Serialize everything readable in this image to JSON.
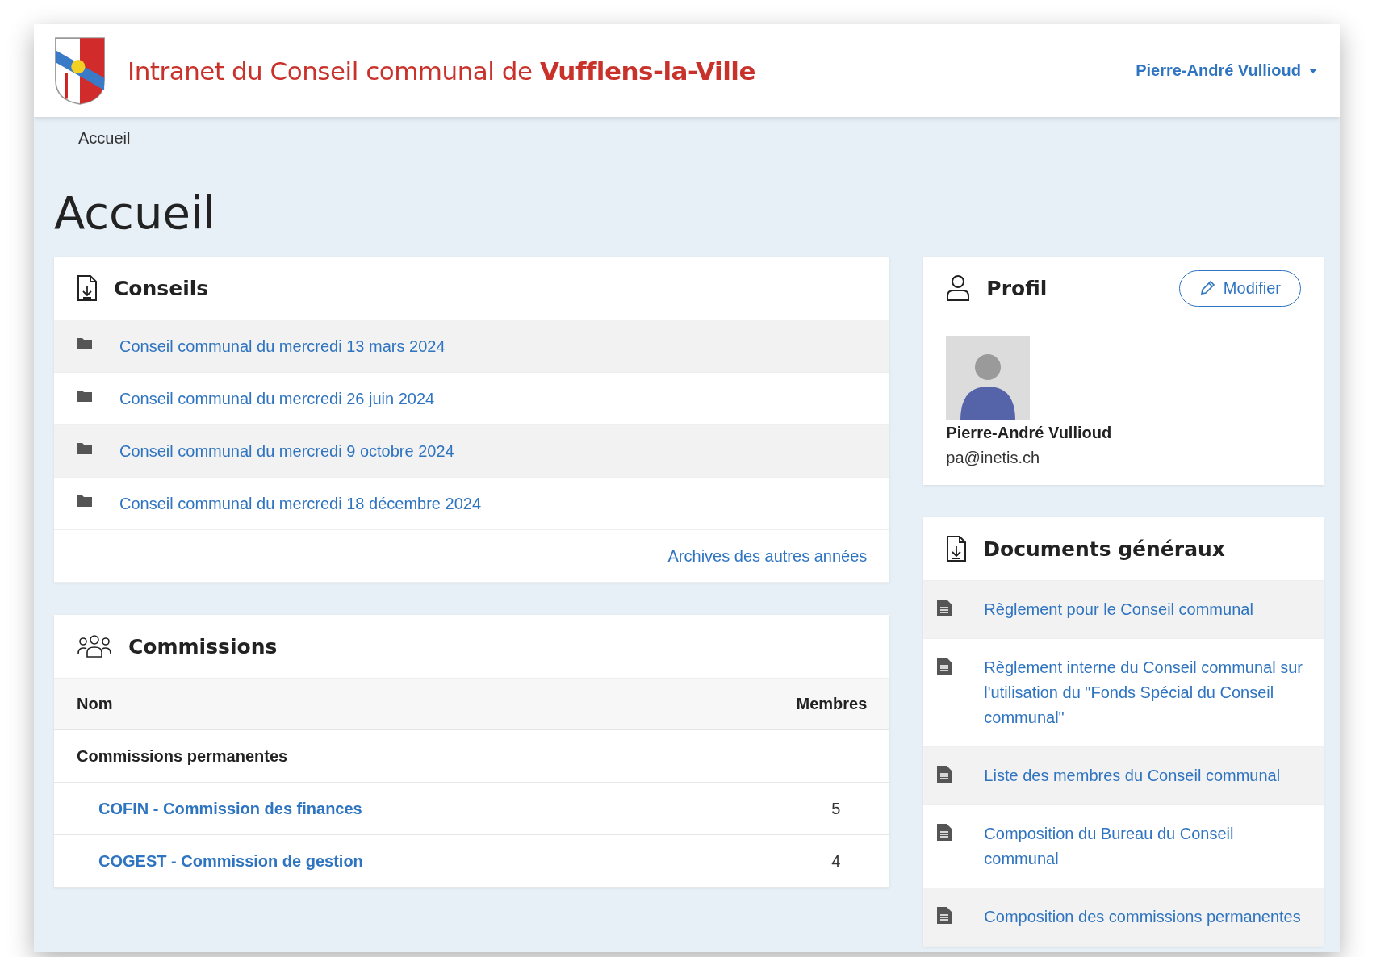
{
  "header": {
    "title": "Intranet du Conseil communal de **Vufflens-la-Ville**",
    "user_menu": "Pierre-André Vullioud"
  },
  "breadcrumb": [
    "Accueil"
  ],
  "page_title": "Accueil",
  "conseils": {
    "title": "Conseils",
    "items": [
      "Conseil communal du mercredi 13 mars 2024",
      "Conseil communal du mercredi 26 juin 2024",
      "Conseil communal du mercredi 9 octobre 2024",
      "Conseil communal du mercredi 18 décembre 2024"
    ],
    "archives_link": "Archives des autres années"
  },
  "commissions": {
    "title": "Commissions",
    "columns": [
      "Nom",
      "Membres"
    ],
    "groups": [
      {
        "name": "Commissions permanentes",
        "rows": [
          {
            "name": "COFIN - Commission des finances",
            "members": "5"
          },
          {
            "name": "COGEST - Commission de gestion",
            "members": "4"
          }
        ]
      }
    ]
  },
  "profil": {
    "title": "Profil",
    "edit_button": "Modifier",
    "name": "Pierre-André Vullioud",
    "email": "pa@inetis.ch"
  },
  "documents": {
    "title": "Documents généraux",
    "items": [
      "Règlement pour le Conseil communal",
      "Règlement interne du Conseil communal sur l'utilisation du \"Fonds Spécial du Conseil communal\"",
      "Liste des membres du Conseil communal",
      "Composition du Bureau du Conseil communal",
      "Composition des commissions permanentes"
    ]
  }
}
